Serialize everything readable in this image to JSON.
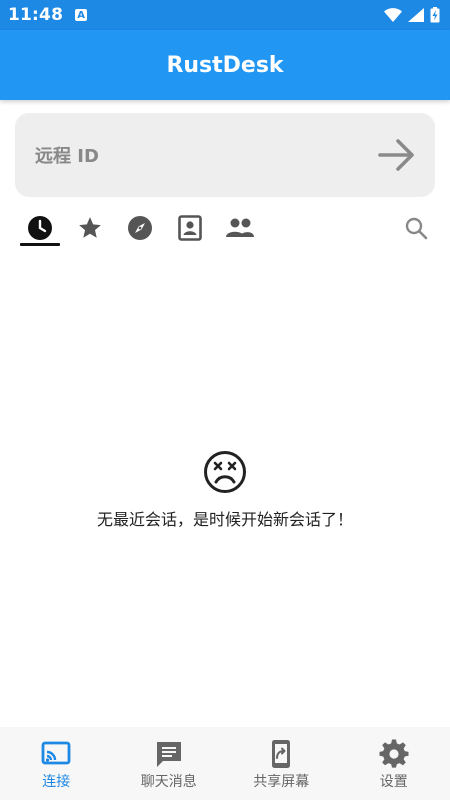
{
  "status_bar": {
    "time": "11:48",
    "notification_badge": "A"
  },
  "app_bar": {
    "title": "RustDesk"
  },
  "connect": {
    "id_placeholder": "远程 ID"
  },
  "tabs": [
    {
      "icon": "clock-icon",
      "active": true
    },
    {
      "icon": "star-icon",
      "active": false
    },
    {
      "icon": "compass-icon",
      "active": false
    },
    {
      "icon": "address-book-icon",
      "active": false
    },
    {
      "icon": "group-icon",
      "active": false
    },
    {
      "icon": "search-icon",
      "active": false
    }
  ],
  "empty_state": {
    "icon": "sad-face-icon",
    "message": "无最近会话，是时候开始新会话了！"
  },
  "bottom_nav": {
    "items": [
      {
        "label": "连接",
        "icon": "cast-icon",
        "active": true
      },
      {
        "label": "聊天消息",
        "icon": "chat-icon",
        "active": false
      },
      {
        "label": "共享屏幕",
        "icon": "share-screen-icon",
        "active": false
      },
      {
        "label": "设置",
        "icon": "gear-icon",
        "active": false
      }
    ]
  },
  "colors": {
    "status_bar": "#1e88e5",
    "app_bar": "#2196f3",
    "accent": "#1e88e5",
    "field_bg": "#eeeeee",
    "nav_bg": "#f7f7f7"
  }
}
